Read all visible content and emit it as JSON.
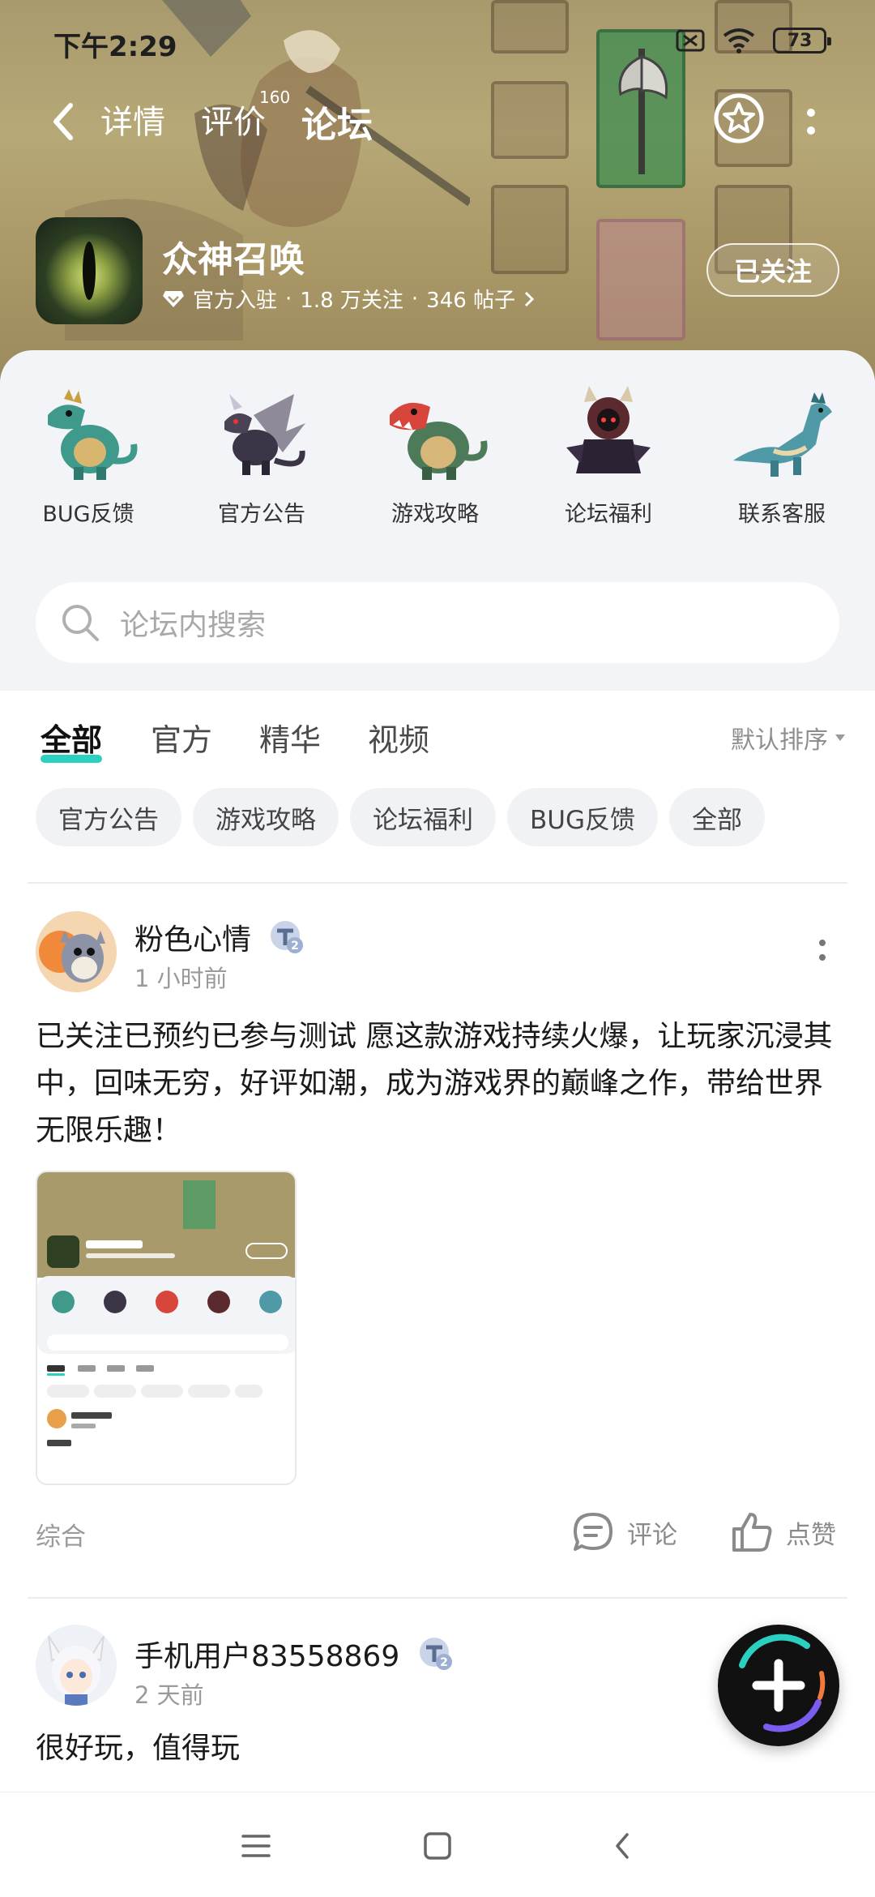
{
  "status_bar": {
    "time": "下午2:29",
    "battery": "73"
  },
  "nav": {
    "tabs": [
      {
        "label": "详情"
      },
      {
        "label": "评价",
        "count": "160"
      },
      {
        "label": "论坛"
      }
    ],
    "active_tab": "论坛"
  },
  "game": {
    "name": "众神召唤",
    "meta": {
      "official": "官方入驻",
      "followers": "1.8 万关注",
      "posts": "346 帖子"
    },
    "follow_label": "已关注"
  },
  "categories": [
    {
      "label": "BUG反馈",
      "icon": "teal-dragon-icon"
    },
    {
      "label": "官方公告",
      "icon": "winged-dragon-icon"
    },
    {
      "label": "游戏攻略",
      "icon": "red-dragon-icon"
    },
    {
      "label": "论坛福利",
      "icon": "dark-knight-icon"
    },
    {
      "label": "联系客服",
      "icon": "blue-dinosaur-icon"
    }
  ],
  "search": {
    "placeholder": "论坛内搜索"
  },
  "feed_tabs": [
    "全部",
    "官方",
    "精华",
    "视频"
  ],
  "sort_label": "默认排序",
  "chips": [
    "官方公告",
    "游戏攻略",
    "论坛福利",
    "BUG反馈",
    "全部"
  ],
  "posts": [
    {
      "user": "粉色心情",
      "time": "1 小时前",
      "text": "已关注已预约已参与测试 愿这款游戏持续火爆，让玩家沉浸其中，回味无穷，好评如潮，成为游戏界的巅峰之作，带给世界无限乐趣！",
      "tag": "综合",
      "comment_label": "评论",
      "like_label": "点赞"
    },
    {
      "user": "手机用户83558869",
      "time": "2 天前",
      "text": "很好玩，值得玩"
    }
  ],
  "colors": {
    "accent": "#2bd0c0",
    "hero_bg": "#a89a6d",
    "panel_bg": "#f3f4f7"
  }
}
